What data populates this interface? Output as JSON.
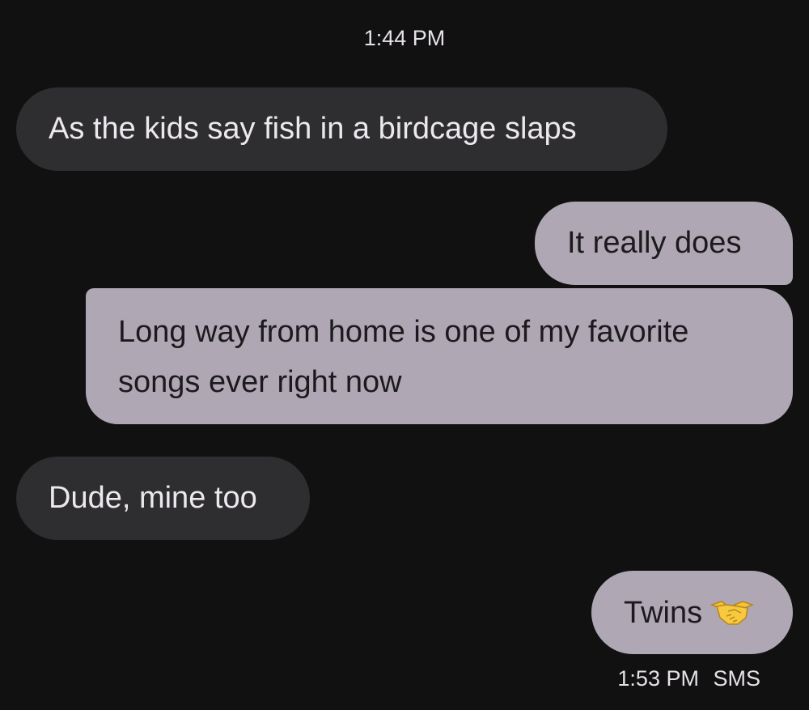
{
  "conversation": {
    "top_timestamp": "1:44 PM",
    "messages": [
      {
        "direction": "incoming",
        "text": "As the kids say fish in a birdcage slaps"
      },
      {
        "direction": "outgoing",
        "text": "It really does"
      },
      {
        "direction": "outgoing",
        "lines": [
          "Long way from home is one of my favorite",
          "songs ever right now"
        ]
      },
      {
        "direction": "incoming",
        "text": "Dude, mine too"
      },
      {
        "direction": "outgoing",
        "text": "Twins",
        "emoji": "handshake-icon"
      }
    ],
    "last_message_time": "1:53 PM",
    "last_message_type": "SMS"
  },
  "colors": {
    "background": "#121112",
    "incoming_bubble": "#2e2d2f",
    "outgoing_bubble": "#afa8b4",
    "emoji": "#f5c33b"
  }
}
